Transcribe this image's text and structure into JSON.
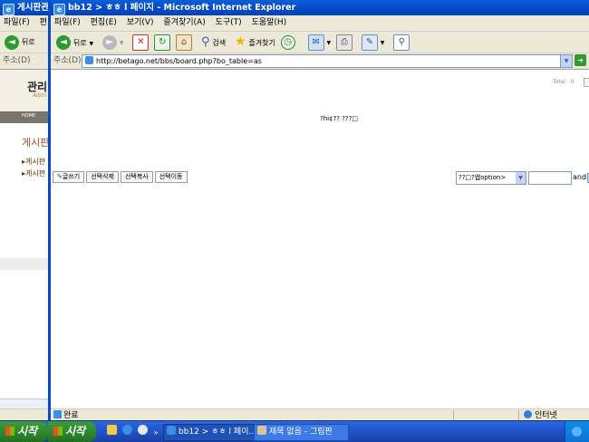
{
  "back_window": {
    "title": "게시판관리",
    "menu": [
      "파일(F)",
      "편"
    ],
    "toolbar": {
      "back_label": "뒤로"
    },
    "address_label": "주소(D)",
    "content": {
      "header_title": "관리",
      "header_sub": "Admi",
      "nav_label": "HOME",
      "section_title": "게시판",
      "links": [
        "게시판",
        "게시판"
      ]
    }
  },
  "main_window": {
    "title": "bb12 > ㅎㅎ l 페이지 - Microsoft Internet Explorer",
    "menu": [
      "파일(F)",
      "편집(E)",
      "보기(V)",
      "즐겨찾기(A)",
      "도구(T)",
      "도움말(H)"
    ],
    "toolbar": {
      "back_label": "뒤로",
      "search_label": "검색",
      "favorites_label": "즐겨찾기"
    },
    "address": {
      "label": "주소(D)",
      "url": "http://betago.net/bbs/board.php?bo_table=as"
    },
    "board": {
      "total_text": "Total : 0",
      "empty_message": "?hi¢?? ???□",
      "buttons": [
        "글쓰기",
        "선택삭제",
        "선택복사",
        "선택이동"
      ],
      "select_value": "??□?웹option>",
      "search_and": "and"
    },
    "status": {
      "text": "완료",
      "zone": "인터넷"
    }
  },
  "taskbar": {
    "start_label": "시작",
    "tasks": [
      "bb12 > ㅎㅎ l 페이...",
      "제목 없음 - 그림판"
    ]
  },
  "colors": {
    "xp_title_blue": "#0549c7",
    "xp_chrome": "#ece9d8",
    "start_green": "#2f8a2f",
    "board_header_bg": "#f3efe3",
    "board_nav_bg": "#7b746a",
    "board_section_brown": "#a0522d"
  },
  "icons": [
    "ie-icon",
    "back-arrow-icon",
    "forward-arrow-icon",
    "stop-icon",
    "refresh-icon",
    "home-icon",
    "search-icon",
    "favorites-star-icon",
    "history-icon",
    "mail-icon",
    "print-icon",
    "edit-icon",
    "go-arrow-icon",
    "windows-logo-icon",
    "zone-globe-icon"
  ]
}
